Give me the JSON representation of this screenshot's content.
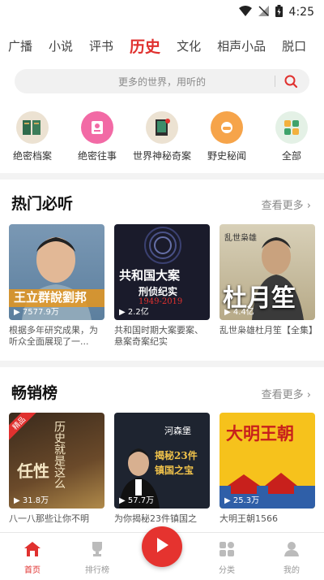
{
  "status_bar": {
    "time": "4:25"
  },
  "tabs": [
    "广播",
    "小说",
    "评书",
    "历史",
    "文化",
    "相声小品",
    "脱口"
  ],
  "active_tab_index": 3,
  "search": {
    "placeholder": "更多的世界，用听的"
  },
  "categories": [
    {
      "label": "绝密档案",
      "icon": "archive-icon",
      "color": "#e9dcc8"
    },
    {
      "label": "绝密往事",
      "icon": "secret-story-icon",
      "color": "#f06aa0"
    },
    {
      "label": "世界神秘奇案",
      "icon": "mystery-book-icon",
      "color": "#e9dcc8"
    },
    {
      "label": "野史秘闻",
      "icon": "unofficial-history-icon",
      "color": "#f7a84a"
    },
    {
      "label": "全部",
      "icon": "all-grid-icon",
      "color": "#dff0e4"
    }
  ],
  "hot": {
    "title": "热门必听",
    "more": "查看更多",
    "items": [
      {
        "count": "7577.9万",
        "desc": "根据多年研究成果，为听众全面展现了一...",
        "cover_text": "王立群說劉邦"
      },
      {
        "count": "2.2亿",
        "desc": "共和国时期大案要案、悬案奇案纪实",
        "cover_text": "共和国大案",
        "cover_sub": "刑侦纪实",
        "cover_years": "1949-2019"
      },
      {
        "count": "4.4亿",
        "desc": "乱世枭雄杜月笙【全集】",
        "cover_text": "杜月笙",
        "cover_small": "乱世枭雄"
      }
    ]
  },
  "best": {
    "title": "畅销榜",
    "more": "查看更多",
    "items": [
      {
        "count": "31.8万",
        "desc": "八一八那些让你不明",
        "tag": "精品",
        "cover_text": "任性",
        "cover_small": "历史就是这么"
      },
      {
        "count": "57.7万",
        "desc": "为你揭秘23件镇国之",
        "cover_text": "揭秘23件",
        "cover_sub": "镇国之宝",
        "cover_small": "河森堡"
      },
      {
        "count": "25.3万",
        "desc": "大明王朝1566",
        "cover_text": "大明王朝"
      }
    ]
  },
  "bottom_nav": [
    {
      "label": "首页",
      "icon": "home-icon",
      "active": true
    },
    {
      "label": "排行榜",
      "icon": "trophy-icon",
      "active": false
    },
    {
      "label": "",
      "icon": "play-icon",
      "active": false
    },
    {
      "label": "分类",
      "icon": "category-grid-icon",
      "active": false
    },
    {
      "label": "我的",
      "icon": "profile-icon",
      "active": false
    }
  ],
  "colors": {
    "accent": "#e0312f"
  }
}
